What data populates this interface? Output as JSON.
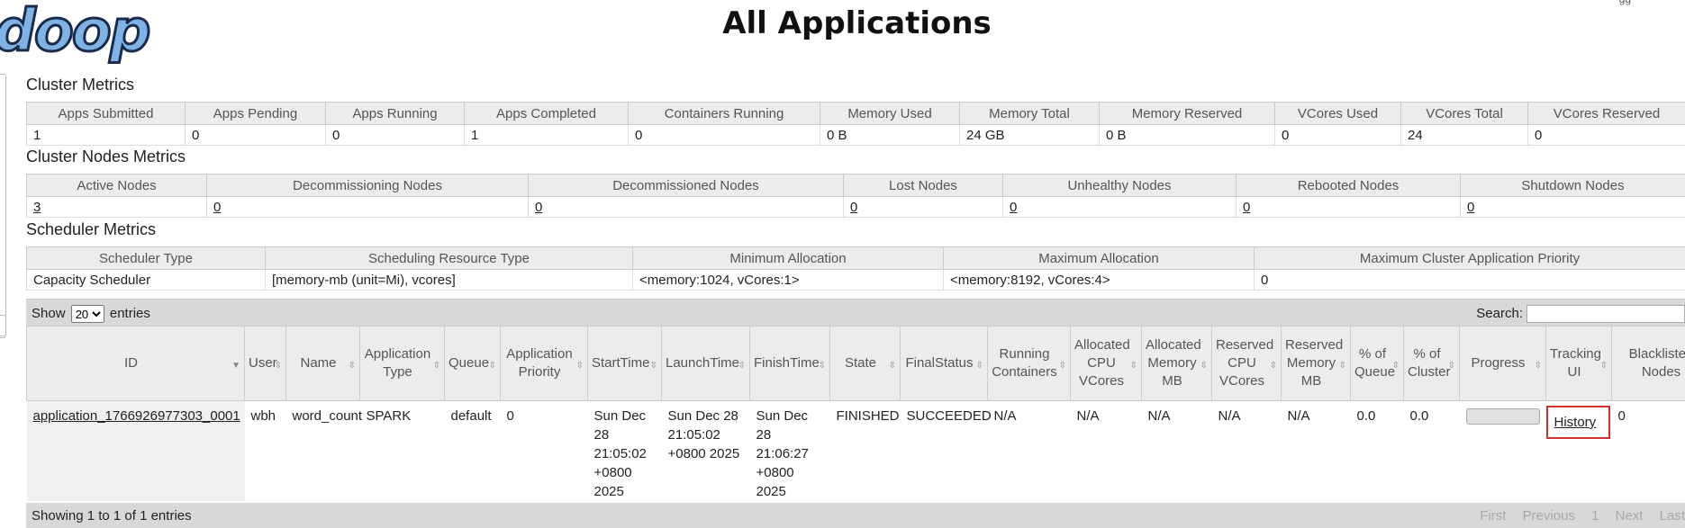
{
  "header": {
    "logo_text": "doop",
    "title": "All Applications",
    "corner_text": "gg"
  },
  "cluster_metrics": {
    "title": "Cluster Metrics",
    "headers": [
      "Apps Submitted",
      "Apps Pending",
      "Apps Running",
      "Apps Completed",
      "Containers Running",
      "Memory Used",
      "Memory Total",
      "Memory Reserved",
      "VCores Used",
      "VCores Total",
      "VCores Reserved"
    ],
    "values": [
      "1",
      "0",
      "0",
      "1",
      "0",
      "0 B",
      "24 GB",
      "0 B",
      "0",
      "24",
      "0"
    ]
  },
  "cluster_nodes_metrics": {
    "title": "Cluster Nodes Metrics",
    "headers": [
      "Active Nodes",
      "Decommissioning Nodes",
      "Decommissioned Nodes",
      "Lost Nodes",
      "Unhealthy Nodes",
      "Rebooted Nodes",
      "Shutdown Nodes"
    ],
    "values": [
      "3",
      "0",
      "0",
      "0",
      "0",
      "0",
      "0"
    ]
  },
  "scheduler_metrics": {
    "title": "Scheduler Metrics",
    "headers": [
      "Scheduler Type",
      "Scheduling Resource Type",
      "Minimum Allocation",
      "Maximum Allocation",
      "Maximum Cluster Application Priority"
    ],
    "values": [
      "Capacity Scheduler",
      "[memory-mb (unit=Mi), vcores]",
      "<memory:1024, vCores:1>",
      "<memory:8192, vCores:4>",
      "0"
    ]
  },
  "controls": {
    "show_label": "Show",
    "entries_value": "20",
    "entries_label": "entries",
    "search_label": "Search:",
    "search_value": ""
  },
  "apps_table": {
    "columns": {
      "id": "ID",
      "user": "User",
      "name": "Name",
      "app_type": "Application Type",
      "queue": "Queue",
      "app_priority": "Application Priority",
      "start_time": "StartTime",
      "launch_time": "LaunchTime",
      "finish_time": "FinishTime",
      "state": "State",
      "final_status": "FinalStatus",
      "running_containers": "Running Containers",
      "alloc_cpu": "Allocated CPU VCores",
      "alloc_mem": "Allocated Memory MB",
      "res_cpu": "Reserved CPU VCores",
      "res_mem": "Reserved Memory MB",
      "pct_queue": "% of Queue",
      "pct_cluster": "% of Cluster",
      "progress": "Progress",
      "tracking_ui": "Tracking UI",
      "blacklisted": "Blacklisted Nodes"
    },
    "rows": [
      {
        "id": "application_1766926977303_0001",
        "user": "wbh",
        "name": "word_count",
        "app_type": "SPARK",
        "queue": "default",
        "app_priority": "0",
        "start_time": "Sun Dec 28 21:05:02 +0800 2025",
        "launch_time": "Sun Dec 28 21:05:02 +0800 2025",
        "finish_time": "Sun Dec 28 21:06:27 +0800 2025",
        "state": "FINISHED",
        "final_status": "SUCCEEDED",
        "running_containers": "N/A",
        "alloc_cpu": "N/A",
        "alloc_mem": "N/A",
        "res_cpu": "N/A",
        "res_mem": "N/A",
        "pct_queue": "0.0",
        "pct_cluster": "0.0",
        "progress": 0,
        "tracking_ui": "History",
        "blacklisted": "0"
      }
    ]
  },
  "footer": {
    "info": "Showing 1 to 1 of 1 entries",
    "pager": {
      "first": "First",
      "previous": "Previous",
      "page": "1",
      "next": "Next",
      "last": "Last"
    }
  },
  "colors": {
    "header_bg": "#ececec",
    "bar_bg": "#d8d8d8",
    "highlight": "#d32f2f"
  }
}
